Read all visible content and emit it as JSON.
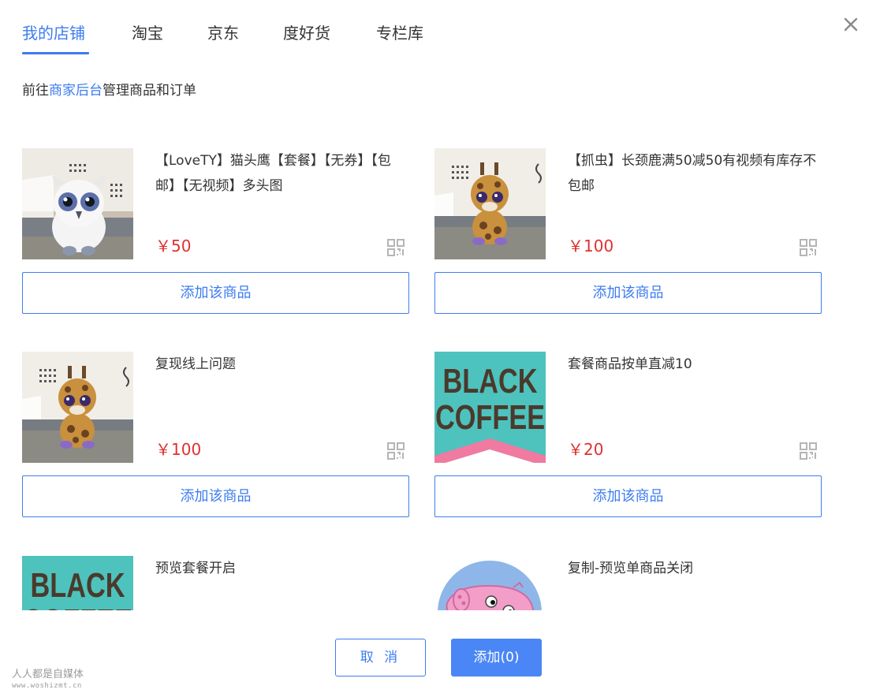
{
  "tabs": [
    {
      "label": "我的店铺",
      "active": true
    },
    {
      "label": "淘宝"
    },
    {
      "label": "京东"
    },
    {
      "label": "度好货"
    },
    {
      "label": "专栏库"
    }
  ],
  "hint": {
    "prefix": "前往",
    "link": "商家后台",
    "suffix": "管理商品和订单"
  },
  "products": [
    {
      "title": "【LoveTY】猫头鹰【套餐】【无券】【包邮】【无视频】多头图",
      "price": "￥50",
      "image": "owl-plush-photo",
      "button": "添加该商品"
    },
    {
      "title": "【抓虫】长颈鹿满50减50有视频有库存不包邮",
      "price": "￥100",
      "image": "giraffe-plush-photo",
      "button": "添加该商品"
    },
    {
      "title": "复现线上问题",
      "price": "￥100",
      "image": "giraffe-plush-photo",
      "button": "添加该商品"
    },
    {
      "title": "套餐商品按单直减10",
      "price": "￥20",
      "image": "black-coffee-logo",
      "button": "添加该商品"
    },
    {
      "title": "预览套餐开启",
      "image": "black-coffee-logo"
    },
    {
      "title": "复制-预览单商品关闭",
      "image": "peppa-pig-cartoon"
    }
  ],
  "thumb_text": {
    "black_coffee_1": "BLACK",
    "black_coffee_2": "COFFEE"
  },
  "footer": {
    "cancel": "取 消",
    "add": "添加(0)"
  },
  "watermark": {
    "line1": "人人都是自媒体",
    "line2": "www.woshizmt.cn"
  },
  "icons": {
    "close": "close-icon",
    "qr": "qr-code-icon"
  },
  "colors": {
    "accent": "#3d7cf0",
    "price": "#e0312e",
    "primary_button": "#4a86f5"
  }
}
